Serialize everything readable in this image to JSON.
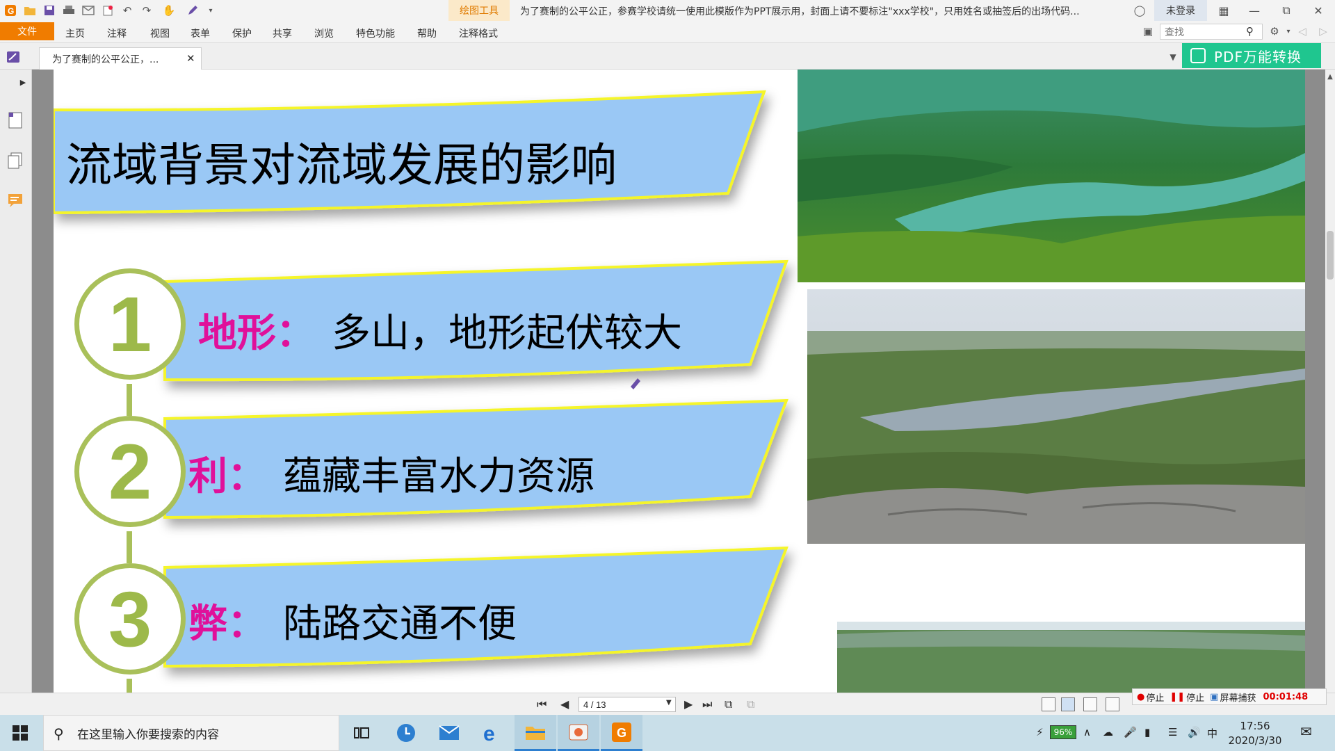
{
  "app": {
    "drawing_tools_tab": "绘图工具",
    "doc_title": "为了赛制的公平公正，参赛学校请统一使用此模版作为PPT展示用，封面上请不要标注\"xxx学校\"，只用姓名或抽签后的出场代码...",
    "login_label": "未登录"
  },
  "menu": {
    "file": "文件",
    "items": [
      "主页",
      "注释",
      "视图",
      "表单",
      "保护",
      "共享",
      "浏览",
      "特色功能",
      "帮助",
      "注释格式"
    ],
    "search_placeholder": "查找"
  },
  "tabs": {
    "doc_tab_label": "为了赛制的公平公正，...",
    "pdf_convert_label": "PDF万能转换"
  },
  "slide": {
    "title": "流域背景对流域发展的影响",
    "items": [
      {
        "number": "1",
        "keyword": "地形：",
        "text": "多山，地形起伏较大"
      },
      {
        "number": "2",
        "keyword": "利：",
        "text": "蕴藏丰富水力资源"
      },
      {
        "number": "3",
        "keyword": "弊：",
        "text": "陆路交通不便"
      }
    ]
  },
  "nav": {
    "page_indicator": "4 / 13"
  },
  "recorder": {
    "stop1": "停止",
    "stop2": "停止",
    "capture": "屏幕捕获",
    "time": "00:01:48"
  },
  "taskbar": {
    "search_placeholder": "在这里输入你要搜索的内容",
    "battery": "96%",
    "ime": "中",
    "time": "17:56",
    "date": "2020/3/30"
  },
  "colors": {
    "accent_orange": "#f07c00",
    "banner_blue": "#9ac8f5",
    "banner_border": "#f5f52a",
    "circle_green": "#a9c05a",
    "keyword_magenta": "#e0109a",
    "pdf_green": "#1fc68f"
  }
}
